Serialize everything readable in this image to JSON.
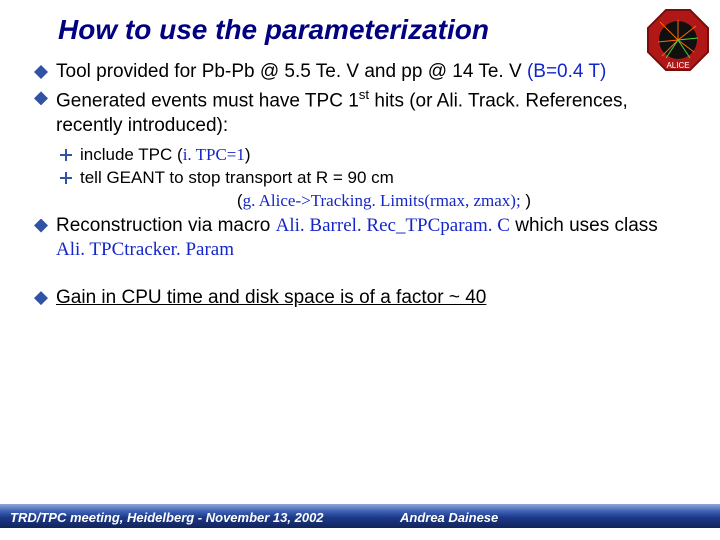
{
  "title": "How to use the parameterization",
  "b1a": "Tool provided for Pb-Pb @ 5.5 Te. V and pp @ 14 Te. V ",
  "b1b": "(B=0.4 T)",
  "b2_pre": "Generated events must have TPC 1",
  "b2_sup": "st",
  "b2_post": " hits (or Ali. Track. References, recently introduced):",
  "s1a": "include TPC (",
  "s1code": "i. TPC=1",
  "s1b": ")",
  "s2": "tell GEANT to stop transport at R = 90 cm",
  "s2code_a": "(",
  "s2code_b": "g. Alice->Tracking. Limits(rmax, zmax);",
  "s2code_c": " )",
  "b3a": "Reconstruction via macro ",
  "b3code1": "Ali. Barrel. Rec_TPCparam. C",
  "b3b": " which uses class ",
  "b3code2": "Ali. TPCtracker. Param",
  "b4": "Gain in CPU time and disk space is of a factor ~ 40",
  "footer_left": "TRD/TPC meeting, Heidelberg - November 13, 2002",
  "footer_right": "Andrea Dainese"
}
